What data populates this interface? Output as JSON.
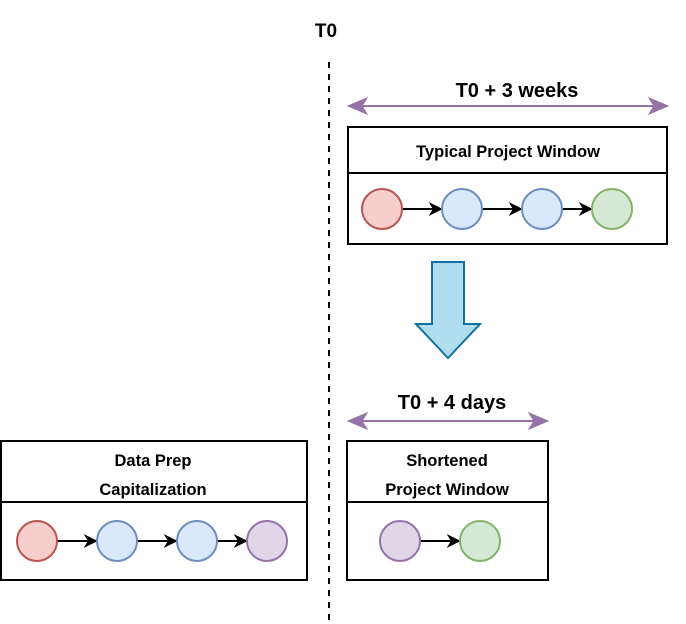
{
  "timeline": {
    "marker_label": "T0"
  },
  "colors": {
    "span_arrow": "#9673a6",
    "transition_arrow_fill": "#b1ddf0",
    "transition_arrow_stroke": "#10739e",
    "box_border": "#000000",
    "connector": "#000000"
  },
  "node_styles": {
    "red": {
      "fill": "#f8cecc",
      "stroke": "#b85450"
    },
    "blue": {
      "fill": "#dae8fc",
      "stroke": "#6c8ebf"
    },
    "green": {
      "fill": "#d5e8d4",
      "stroke": "#82b366"
    },
    "purple": {
      "fill": "#e1d5e7",
      "stroke": "#9673a6"
    }
  },
  "typical": {
    "span_label": "T0 + 3 weeks",
    "title": "Typical Project Window",
    "nodes": [
      "red",
      "blue",
      "blue",
      "green"
    ]
  },
  "transition": {
    "direction": "down"
  },
  "shortened": {
    "span_label": "T0 + 4 days",
    "title_line1": "Shortened",
    "title_line2": "Project Window",
    "nodes": [
      "purple",
      "green"
    ]
  },
  "dataprep": {
    "title_line1": "Data Prep",
    "title_line2": "Capitalization",
    "nodes": [
      "red",
      "blue",
      "blue",
      "purple"
    ]
  }
}
